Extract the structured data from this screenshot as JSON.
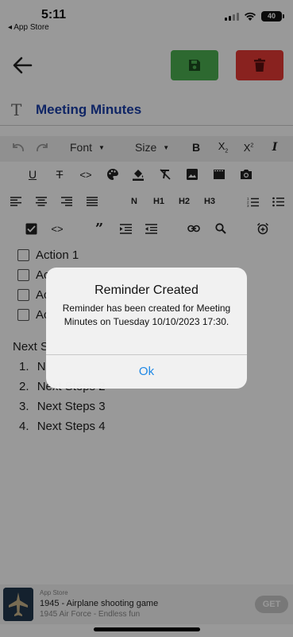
{
  "status_bar": {
    "time": "5:11",
    "back_label": "◂ App Store",
    "battery": "40"
  },
  "colors": {
    "save": "#4caf50",
    "delete": "#e53935",
    "title": "#1a3ea8",
    "dialog_button": "#1e88e5"
  },
  "note": {
    "title": "Meeting Minutes"
  },
  "toolbar": {
    "font_label": "Font",
    "size_label": "Size",
    "heading_labels": {
      "normal": "N",
      "h1": "H1",
      "h2": "H2",
      "h3": "H3"
    },
    "icons": [
      "undo-icon",
      "redo-icon",
      "bold-icon",
      "subscript-icon",
      "superscript-icon",
      "italic-icon",
      "underline-icon",
      "strikethrough-icon",
      "code-icon",
      "palette-icon",
      "fill-color-icon",
      "clear-format-icon",
      "image-icon",
      "video-icon",
      "camera-icon",
      "align-left-icon",
      "align-center-icon",
      "align-right-icon",
      "justify-icon",
      "numbered-list-icon",
      "bullet-list-icon",
      "checkbox-icon",
      "code-block-icon",
      "quote-icon",
      "indent-icon",
      "outdent-icon",
      "link-icon",
      "search-icon",
      "alarm-icon"
    ]
  },
  "content": {
    "checklist": [
      {
        "label": "Action 1"
      },
      {
        "label": "Ac"
      },
      {
        "label": "Ac"
      },
      {
        "label": "Ac"
      }
    ],
    "next_steps_heading": "Next S",
    "ordered_list": [
      {
        "num": "1.",
        "label": "N"
      },
      {
        "num": "2.",
        "label": "Next Steps 2"
      },
      {
        "num": "3.",
        "label": "Next Steps 3"
      },
      {
        "num": "4.",
        "label": "Next Steps 4"
      }
    ]
  },
  "dialog": {
    "title": "Reminder Created",
    "message": "Reminder has been created for Meeting Minutes on Tuesday 10/10/2023 17:30.",
    "ok_label": "Ok"
  },
  "ad": {
    "store_label": "App Store",
    "title": "1945 - Airplane shooting game",
    "subtitle": "1945 Air Force - Endless fun",
    "get_label": "GET"
  }
}
